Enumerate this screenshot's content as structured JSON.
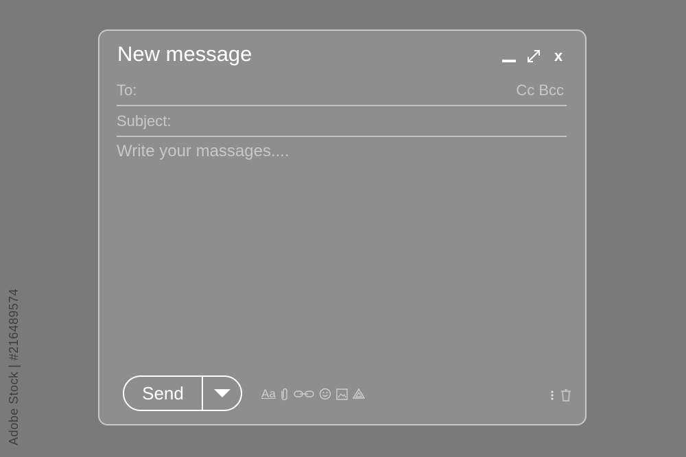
{
  "window": {
    "title": "New message"
  },
  "fields": {
    "to_label": "To:",
    "cc_label": "Cc",
    "bcc_label": "Bcc",
    "subject_label": "Subject:",
    "body_placeholder": "Write your massages...."
  },
  "actions": {
    "send_label": "Send",
    "format_label": "Aa"
  },
  "icons": {
    "window_controls": [
      "minimize-icon",
      "expand-icon",
      "close-icon"
    ],
    "close_glyph": "x",
    "toolbar": [
      "text-format-icon",
      "attach-icon",
      "link-icon",
      "emoji-icon",
      "image-icon",
      "drive-icon"
    ],
    "right": [
      "more-options-icon",
      "trash-icon"
    ]
  },
  "watermark": {
    "id_text": "Adobe Stock | #216489574"
  },
  "colors": {
    "background": "#7a7a7a",
    "window_fill": "#8e8e8e",
    "window_border": "#c9c9c9",
    "text_muted": "#c8c8c8",
    "text_white": "#ffffff"
  }
}
